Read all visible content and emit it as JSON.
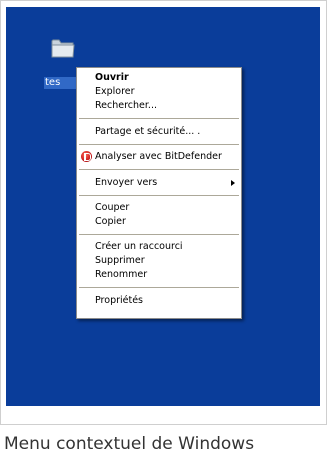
{
  "desktop": {
    "background_color": "#0a3d9a",
    "folder_icon": "folder-icon",
    "folder_label": "tes"
  },
  "context_menu": {
    "items": [
      {
        "label": "Ouvrir",
        "bold": true
      },
      {
        "label": "Explorer"
      },
      {
        "label": "Rechercher..."
      },
      {
        "label": "Partage et sécurité... ."
      },
      {
        "label": "Analyser avec BitDefender",
        "icon": "bitdefender-icon"
      },
      {
        "label": "Envoyer vers",
        "submenu": true
      },
      {
        "label": "Couper"
      },
      {
        "label": "Copier"
      },
      {
        "label": "Créer un raccourci"
      },
      {
        "label": "Supprimer"
      },
      {
        "label": "Renommer"
      },
      {
        "label": "Propriétés"
      }
    ]
  },
  "caption": "Menu contextuel de Windows"
}
